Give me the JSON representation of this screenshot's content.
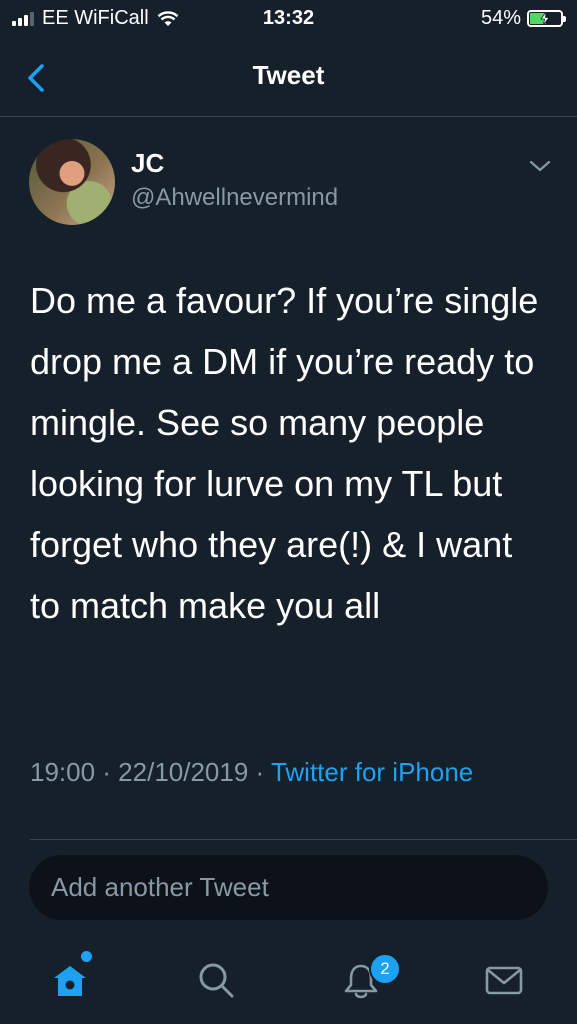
{
  "status_bar": {
    "carrier": "EE WiFiCall",
    "time": "13:32",
    "battery_percent": "54%",
    "battery_level": 0.54,
    "signal_bars_filled": 3,
    "charging": true
  },
  "nav": {
    "title": "Tweet",
    "back_icon": "chevron-left-icon"
  },
  "tweet": {
    "author_name": "JC",
    "author_handle": "@Ahwellnevermind",
    "text": "Do me a favour? If you’re single drop me a DM if you’re ready to mingle. See so many people looking for lurve on my TL but forget who they are(!) & I want to match make you all",
    "timestamp": "19:00 · 22/10/2019 · ",
    "source": "Twitter for iPhone"
  },
  "reply": {
    "placeholder": "Add another Tweet"
  },
  "tab_bar": {
    "tabs": [
      {
        "name": "home",
        "icon": "home-icon"
      },
      {
        "name": "search",
        "icon": "search-icon"
      },
      {
        "name": "notifications",
        "icon": "bell-icon"
      },
      {
        "name": "messages",
        "icon": "mail-icon"
      }
    ],
    "notification_count": "2"
  },
  "colors": {
    "background": "#15202b",
    "accent": "#1da1f2",
    "secondary_text": "#8899a6",
    "divider": "#38444d",
    "battery": "#4cd964"
  }
}
